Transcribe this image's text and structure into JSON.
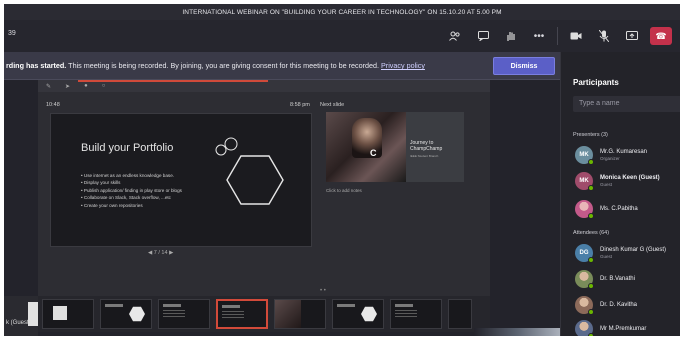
{
  "window": {
    "title": "INTERNATIONAL WEBINAR ON \"BUILDING YOUR CAREER IN TECHNOLOGY\" ON 15.10.20 AT 5.00 PM"
  },
  "toolbar": {
    "left_text": "39",
    "icons": [
      "people-icon",
      "chat-icon",
      "raise-hand-icon",
      "more-icon",
      "camera-icon",
      "mic-icon",
      "share-icon",
      "hangup-icon"
    ]
  },
  "banner": {
    "bold": "rding has started.",
    "text": " This meeting is being recorded. By joining, you are giving consent for this meeting to be recorded.",
    "link": "Privacy policy",
    "dismiss_label": "Dismiss"
  },
  "presenter": {
    "time_left": "10:48",
    "time_right": "8:58 pm",
    "next_label": "Next slide",
    "slide_title": "Build your Portfolio",
    "bullets": [
      "Use internet as an endless knowledge base.",
      "Display your skills",
      "Publish application/ finding in play store or blogs",
      "Collaborate on Slack, Stack overflow, ...etc",
      "Create your own repositories"
    ],
    "counter": "7 / 14",
    "next_slide_text": "Journey to ChampChamp",
    "next_slide_sub": "IEEE Student Branch",
    "notes": "Click to add notes"
  },
  "bottom": {
    "guest_label": "k (Guest)"
  },
  "participants": {
    "title": "Participants",
    "search_placeholder": "Type a name",
    "presenters_label": "Presenters (3)",
    "attendees_label": "Attendees (64)",
    "presenters": [
      {
        "initials": "MK",
        "name": "Mr.G. Kumaresan",
        "role": "Organizer",
        "color": "#6b8e9e"
      },
      {
        "initials": "MK",
        "name": "Monica Keen (Guest)",
        "role": "Guest",
        "color": "#a04c6b"
      },
      {
        "initials": "",
        "name": "Ms. C.Pabitha",
        "role": "",
        "color": "#c35a8a"
      }
    ],
    "attendees": [
      {
        "initials": "DG",
        "name": "Dinesh Kumar G (Guest)",
        "role": "Guest",
        "color": "#4a7fa8"
      },
      {
        "initials": "",
        "name": "Dr. B.Vanathi",
        "role": "",
        "color": "#7a8c5a"
      },
      {
        "initials": "",
        "name": "Dr. D. Kavitha",
        "role": "",
        "color": "#8c6a5a"
      },
      {
        "initials": "",
        "name": "Mr M.Premkumar",
        "role": "",
        "color": "#5a6a8c"
      }
    ]
  }
}
